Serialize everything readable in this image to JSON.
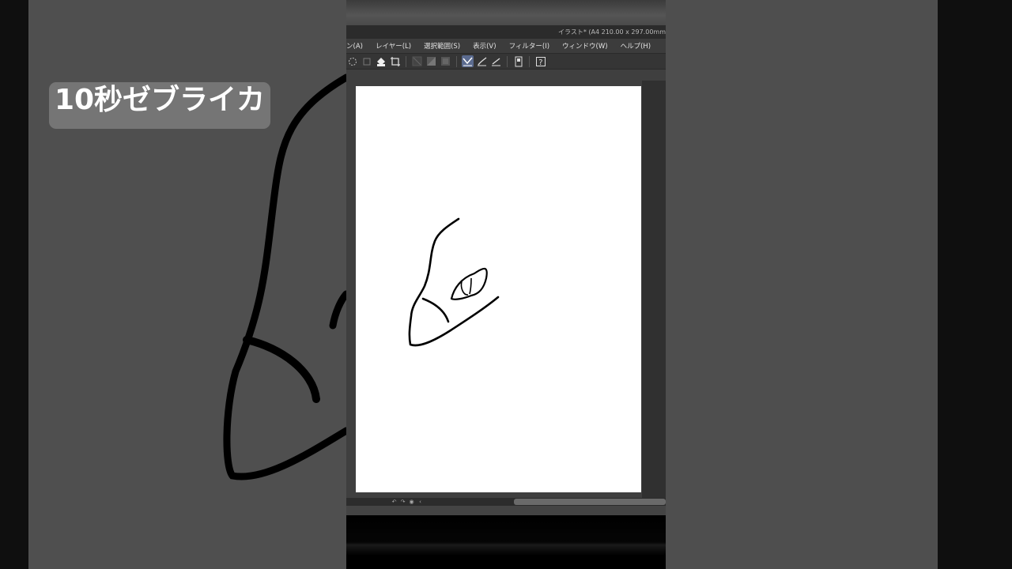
{
  "window": {
    "title": "イラスト* (A4 210.00 x 297.00mm"
  },
  "menu": {
    "items": [
      {
        "label": "ン(A)"
      },
      {
        "label": "レイヤー(L)"
      },
      {
        "label": "選択範囲(S)"
      },
      {
        "label": "表示(V)"
      },
      {
        "label": "フィルター(I)"
      },
      {
        "label": "ウィンドウ(W)"
      },
      {
        "label": "ヘルプ(H)"
      }
    ]
  },
  "toolbar": {
    "icons": [
      "select-marquee-icon",
      "transform-icon",
      "fill-icon",
      "crop-icon",
      "snap-off-icon",
      "snap-fill-icon",
      "snap-square-icon",
      "ruler-snap-icon",
      "pen-tool-icon",
      "brush-tool-icon",
      "device-icon",
      "help-icon"
    ],
    "active_index": 8
  },
  "overlay": {
    "caption": "10秒ゼブライカ"
  },
  "colors": {
    "canvas": "#ffffff",
    "caption_bg": "#808080",
    "active_tool": "#5b6b8f"
  }
}
